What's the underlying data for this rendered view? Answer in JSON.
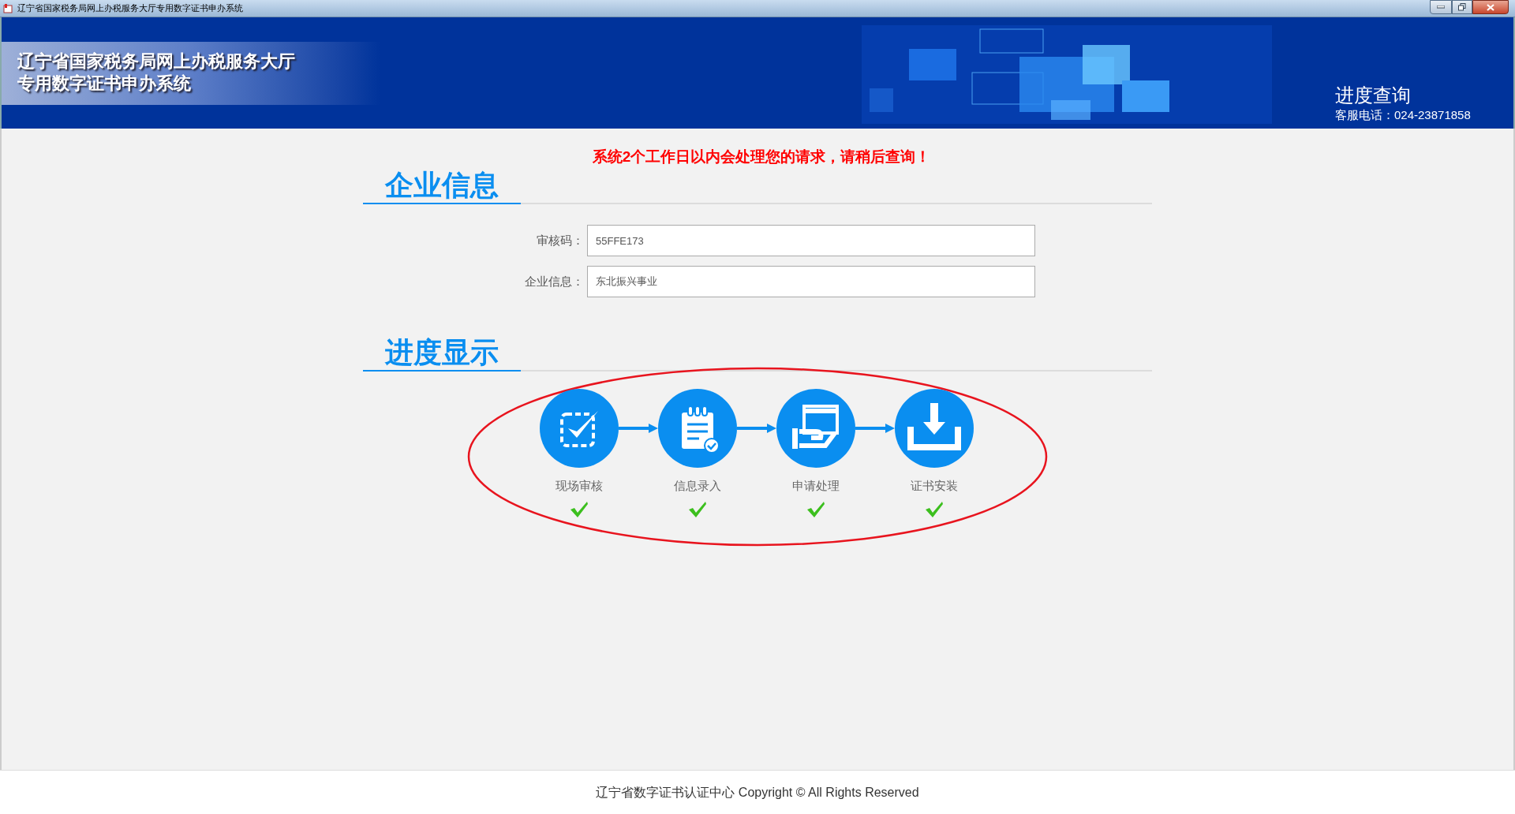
{
  "window": {
    "title": "辽宁省国家税务局网上办税服务大厅专用数字证书申办系统"
  },
  "header": {
    "title_lines": [
      "辽宁省国家税务局网上办税服务大厅",
      "专用数字证书申办系统"
    ],
    "page_title": "进度查询",
    "hotline": "客服电话：024-23871858"
  },
  "notice": "系统2个工作日以内会处理您的请求，请稍后查询！",
  "company_section": {
    "heading": "企业信息",
    "fields": [
      {
        "label": "审核码：",
        "value": "55FFE173"
      },
      {
        "label": "企业信息：",
        "value": "东北振兴事业"
      }
    ]
  },
  "progress_section": {
    "heading": "进度显示",
    "steps": [
      {
        "kind": "review",
        "label": "现场审核",
        "done": true
      },
      {
        "kind": "entry",
        "label": "信息录入",
        "done": true
      },
      {
        "kind": "processing",
        "label": "申请处理",
        "done": true
      },
      {
        "kind": "install",
        "label": "证书安装",
        "done": true
      }
    ]
  },
  "footer": "辽宁省数字证书认证中心 Copyright © All Rights Reserved"
}
